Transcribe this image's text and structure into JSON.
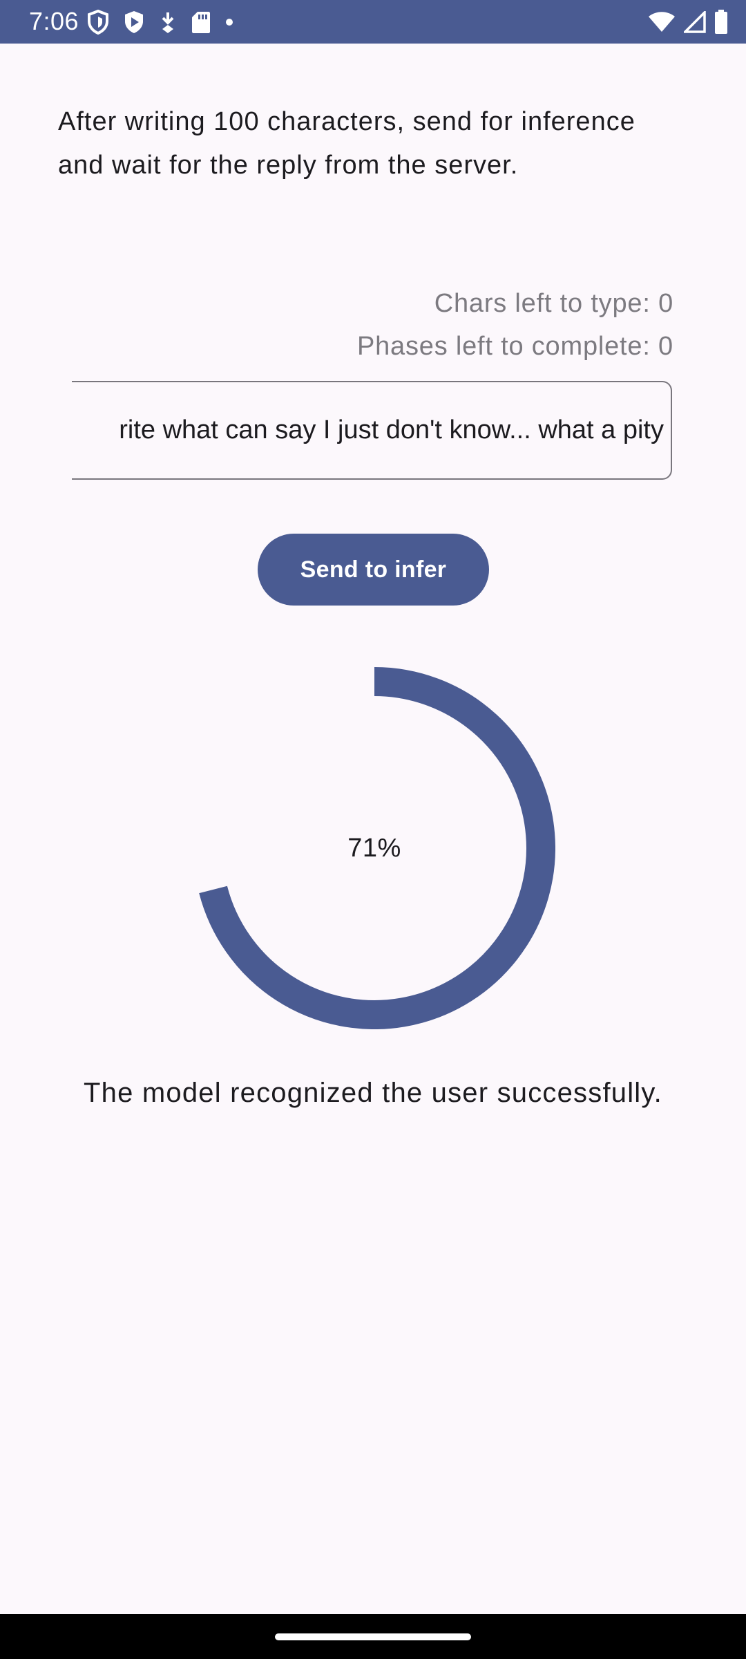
{
  "status_bar": {
    "time": "7:06",
    "bg_color": "#4a5b92",
    "left_icons": [
      "shield-icon",
      "play-protect-icon",
      "download-icon",
      "sd-card-icon",
      "dot-icon"
    ],
    "right_icons": [
      "wifi-icon",
      "signal-icon",
      "battery-icon"
    ]
  },
  "main": {
    "instructions": "After writing 100 characters, send for inference and wait for the reply from the server.",
    "chars_left": "Chars left to type: 0",
    "phases_left": "Phases left to complete: 0",
    "text_field": {
      "value": "rite what can say I just don't know... what a pity"
    },
    "send_button_label": "Send to infer",
    "progress": {
      "label": "71%",
      "value": 0.71,
      "color": "#4a5b92"
    },
    "result": "The model recognized the user successfully."
  }
}
